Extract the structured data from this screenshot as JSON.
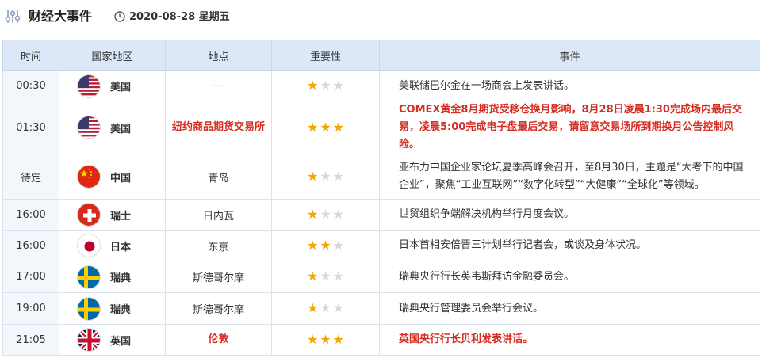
{
  "header": {
    "title": "财经大事件",
    "date": "2020-08-28 星期五"
  },
  "colors": {
    "accent": "#d42d22",
    "header_bg": "#dce8f7",
    "star_on": "#f0a800",
    "star_off": "#d8d8d8"
  },
  "columns": [
    "时间",
    "国家地区",
    "地点",
    "重要性",
    "事件"
  ],
  "rows": [
    {
      "time": "00:30",
      "flag": "us-flag-icon",
      "country": "美国",
      "place": "---",
      "stars": 1,
      "highlight": false,
      "event": "美联储巴尔金在一场商会上发表讲话。"
    },
    {
      "time": "01:30",
      "flag": "us-flag-icon",
      "country": "美国",
      "place": "纽约商品期货交易所",
      "stars": 3,
      "highlight": true,
      "event": "COMEX黄金8月期货受移仓换月影响，8月28日凌晨1:30完成场内最后交易，凌晨5:00完成电子盘最后交易，请留意交易场所到期换月公告控制风险。"
    },
    {
      "time": "待定",
      "flag": "cn-flag-icon",
      "country": "中国",
      "place": "青岛",
      "stars": 1,
      "highlight": false,
      "event": "亚布力中国企业家论坛夏季高峰会召开，至8月30日，主题是“大考下的中国企业”，聚焦“工业互联网”“数字化转型”“大健康”“全球化”等领域。"
    },
    {
      "time": "16:00",
      "flag": "ch-flag-icon",
      "country": "瑞士",
      "place": "日内瓦",
      "stars": 1,
      "highlight": false,
      "event": "世贸组织争端解决机构举行月度会议。"
    },
    {
      "time": "16:00",
      "flag": "jp-flag-icon",
      "country": "日本",
      "place": "东京",
      "stars": 2,
      "highlight": false,
      "event": "日本首相安倍晋三计划举行记者会，或谈及身体状况。"
    },
    {
      "time": "17:00",
      "flag": "se-flag-icon",
      "country": "瑞典",
      "place": "斯德哥尔摩",
      "stars": 1,
      "highlight": false,
      "event": "瑞典央行行长英韦斯拜访金融委员会。"
    },
    {
      "time": "19:00",
      "flag": "se-flag-icon",
      "country": "瑞典",
      "place": "斯德哥尔摩",
      "stars": 1,
      "highlight": false,
      "event": "瑞典央行管理委员会举行会议。"
    },
    {
      "time": "21:05",
      "flag": "uk-flag-icon",
      "country": "英国",
      "place": "伦敦",
      "stars": 3,
      "highlight": true,
      "event": "英国央行行长贝利发表讲话。"
    }
  ]
}
